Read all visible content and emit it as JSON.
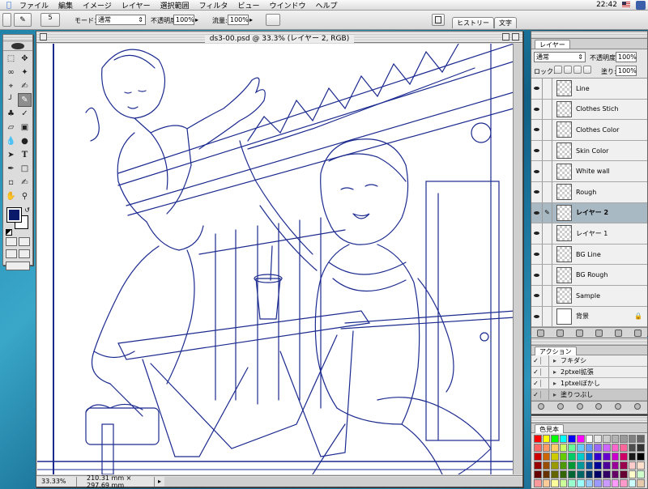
{
  "menubar": {
    "items": [
      "ファイル",
      "編集",
      "イメージ",
      "レイヤー",
      "選択範囲",
      "フィルタ",
      "ビュー",
      "ウインドウ",
      "ヘルプ"
    ],
    "clock": "22:42"
  },
  "options": {
    "brush_size": "5",
    "mode_label": "モード：",
    "mode_value": "通常",
    "opacity_label": "不透明度:",
    "opacity_value": "100%",
    "flow_label": "流量:",
    "flow_value": "100%",
    "tabs": [
      "ヒストリー",
      "文字"
    ]
  },
  "document": {
    "title": "ds3-00.psd @ 33.3% (レイヤー 2, RGB)",
    "zoom": "33.33%",
    "info": "210.31 mm × 297.69 mm",
    "line_color": "#1b2a8f"
  },
  "tools": {
    "foreground_color": "#0a1a6b",
    "background_color": "#ffffff"
  },
  "layers": {
    "tab": "レイヤー",
    "blend_mode": "通常",
    "opacity_label": "不透明度:",
    "opacity_value": "100%",
    "lock_label": "ロック:",
    "fill_label": "塗り:",
    "fill_value": "100%",
    "rows": [
      {
        "name": "Line"
      },
      {
        "name": "Clothes Stich"
      },
      {
        "name": "Clothes Color"
      },
      {
        "name": "Skin Color"
      },
      {
        "name": "White wall"
      },
      {
        "name": "Rough"
      },
      {
        "name": "レイヤー 2",
        "selected": true
      },
      {
        "name": "レイヤー 1"
      },
      {
        "name": "BG Line"
      },
      {
        "name": "BG Rough"
      },
      {
        "name": "Sample"
      },
      {
        "name": "背景",
        "locked": true
      }
    ]
  },
  "actions": {
    "tab": "アクション",
    "rows": [
      "フキダシ",
      "2ptxel拡張",
      "1ptxelぼかし",
      "塗りつぶし"
    ]
  },
  "swatches": {
    "tab": "色見本",
    "colors": [
      "#ff0000",
      "#ffff00",
      "#00ff00",
      "#00ffff",
      "#0000ff",
      "#ff00ff",
      "#ffffff",
      "#e6e6e6",
      "#cccccc",
      "#b3b3b3",
      "#999999",
      "#808080",
      "#666666",
      "#ff6666",
      "#ff9966",
      "#ffcc66",
      "#ccff66",
      "#66ff99",
      "#66ccff",
      "#6699ff",
      "#9966ff",
      "#cc66ff",
      "#ff66cc",
      "#ff6699",
      "#4d4d4d",
      "#333333",
      "#cc0000",
      "#cc6600",
      "#cccc00",
      "#66cc00",
      "#00cc66",
      "#00cccc",
      "#0066cc",
      "#3300cc",
      "#6600cc",
      "#cc00cc",
      "#cc0066",
      "#1a1a1a",
      "#000000",
      "#990000",
      "#994d00",
      "#999900",
      "#4d9900",
      "#009933",
      "#009999",
      "#004d99",
      "#000099",
      "#4d0099",
      "#990099",
      "#99004d",
      "#ffcccc",
      "#ffe0cc",
      "#660000",
      "#663300",
      "#666600",
      "#336600",
      "#006633",
      "#006666",
      "#003366",
      "#000066",
      "#330066",
      "#660066",
      "#660033",
      "#ffffcc",
      "#ccffcc",
      "#ff9999",
      "#ffcc99",
      "#ffff99",
      "#ccff99",
      "#99ffcc",
      "#99ffff",
      "#99ccff",
      "#9999ff",
      "#cc99ff",
      "#ff99ff",
      "#ff99cc",
      "#ccffff",
      "#e5c9a8"
    ]
  }
}
